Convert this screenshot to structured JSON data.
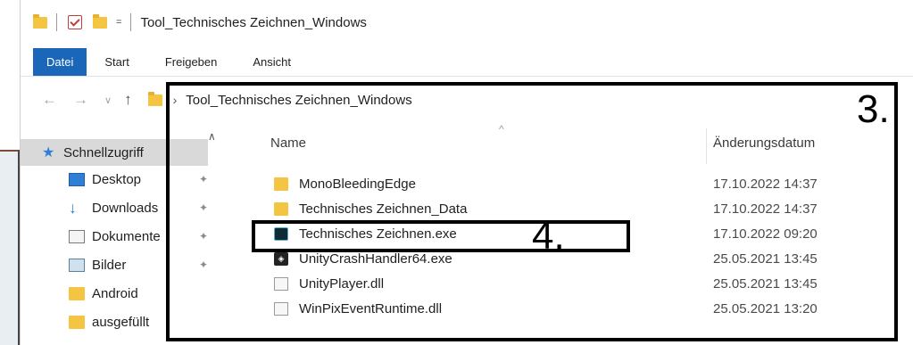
{
  "titlebar": {
    "title": "Tool_Technisches Zeichnen_Windows",
    "dropdown_glyph": "="
  },
  "ribbon": {
    "tabs": [
      {
        "label": "Datei",
        "active": true
      },
      {
        "label": "Start",
        "active": false
      },
      {
        "label": "Freigeben",
        "active": false
      },
      {
        "label": "Ansicht",
        "active": false
      }
    ]
  },
  "address": {
    "path": "Tool_Technisches Zeichnen_Windows"
  },
  "nav": {
    "items": [
      {
        "label": "Schnellzugriff",
        "icon": "star-icon",
        "pinned": false,
        "selected": true
      },
      {
        "label": "Desktop",
        "icon": "desktop-icon",
        "pinned": true
      },
      {
        "label": "Downloads",
        "icon": "download-icon",
        "pinned": true
      },
      {
        "label": "Dokumente",
        "icon": "document-icon",
        "pinned": true
      },
      {
        "label": "Bilder",
        "icon": "pictures-icon",
        "pinned": true
      },
      {
        "label": "Android",
        "icon": "folder-icon",
        "pinned": false
      },
      {
        "label": "ausgefüllt",
        "icon": "folder-icon",
        "pinned": false
      }
    ]
  },
  "files": {
    "columns": {
      "name": "Name",
      "date": "Änderungsdatum"
    },
    "rows": [
      {
        "name": "MonoBleedingEdge",
        "date": "17.10.2022 14:37",
        "icon": "folder-icon"
      },
      {
        "name": "Technisches Zeichnen_Data",
        "date": "17.10.2022 14:37",
        "icon": "folder-icon"
      },
      {
        "name": "Technisches Zeichnen.exe",
        "date": "17.10.2022 09:20",
        "icon": "app-exe-icon"
      },
      {
        "name": "UnityCrashHandler64.exe",
        "date": "25.05.2021 13:45",
        "icon": "unity-exe-icon"
      },
      {
        "name": "UnityPlayer.dll",
        "date": "25.05.2021 13:45",
        "icon": "dll-icon"
      },
      {
        "name": "WinPixEventRuntime.dll",
        "date": "25.05.2021 13:20",
        "icon": "dll-icon"
      }
    ]
  },
  "annotations": {
    "box3_label": "3.",
    "box4_label": "4."
  },
  "colors": {
    "accent": "#1a66b8",
    "folder": "#f4c542",
    "selection": "#d9d9d9"
  }
}
